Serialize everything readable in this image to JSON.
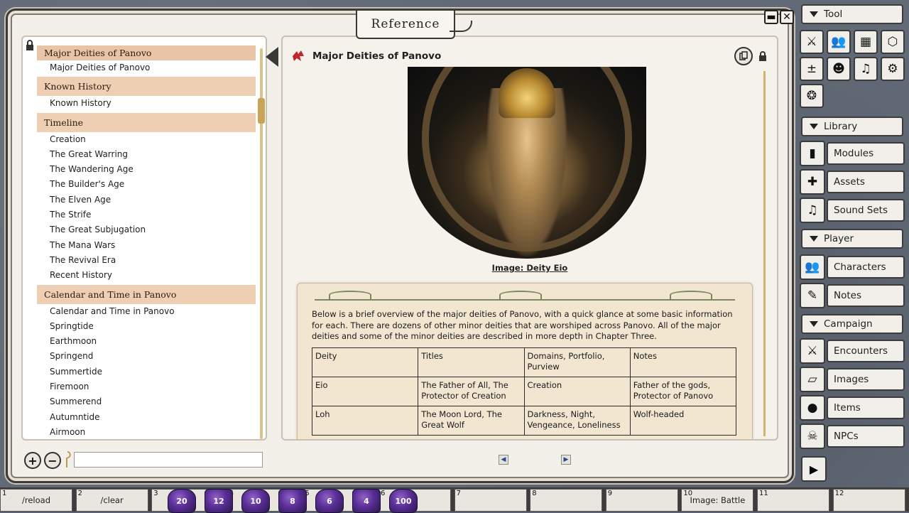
{
  "window": {
    "title": "Reference"
  },
  "list": {
    "groups": [
      {
        "header": "Major Deities of Panovo",
        "items": [
          "Major Deities of Panovo"
        ]
      },
      {
        "header": "Known History",
        "items": [
          "Known History"
        ]
      },
      {
        "header": "Timeline",
        "items": [
          "Creation",
          "The Great Warring",
          "The Wandering Age",
          "The Builder's Age",
          "The Elven Age",
          "The Strife",
          "The Great Subjugation",
          "The Mana Wars",
          "The Revival Era",
          "Recent History"
        ]
      },
      {
        "header": "Calendar and Time in Panovo",
        "items": [
          "Calendar and Time in Panovo",
          "Springtide",
          "Earthmoon",
          "Springend",
          "Summertide",
          "Firemoon",
          "Summerend",
          "Autumntide",
          "Airmoon"
        ]
      }
    ]
  },
  "content": {
    "title": "Major Deities of Panovo",
    "image_caption": "Image: Deity Eio",
    "intro": "Below is a brief overview of the major deities of Panovo, with a quick glance at some basic information for each. There are dozens of other minor deities that are worshiped across Panovo. All of the major deities and some of the minor deities are described in more depth in Chapter Three.",
    "table": {
      "headers": [
        "Deity",
        "Titles",
        "Domains, Portfolio, Purview",
        "Notes"
      ],
      "rows": [
        [
          "Eio",
          "The Father of All, The Protector of Creation",
          "Creation",
          "Father of the gods, Protector of Panovo"
        ],
        [
          "Loh",
          "The Moon Lord, The Great Wolf",
          "Darkness, Night, Vengeance, Loneliness",
          "Wolf-headed"
        ]
      ]
    }
  },
  "sidebar": {
    "tool_header": "Tool",
    "tool_icons": [
      "sword-icon",
      "users-icon",
      "calendar-icon",
      "d20-icon",
      "modifier-icon",
      "user-gear-icon",
      "music-icon",
      "settings-icon",
      "effects-icon"
    ],
    "library_header": "Library",
    "library_items": [
      "Modules",
      "Assets",
      "Sound Sets"
    ],
    "player_header": "Player",
    "player_items": [
      "Characters",
      "Notes"
    ],
    "campaign_header": "Campaign",
    "campaign_items": [
      "Encounters",
      "Images",
      "Items",
      "NPCs"
    ]
  },
  "hotkeys": {
    "slots": [
      {
        "num": "1",
        "label": "/reload"
      },
      {
        "num": "2",
        "label": "/clear"
      },
      {
        "num": "3",
        "label": ""
      },
      {
        "num": "4",
        "label": ""
      },
      {
        "num": "5",
        "label": ""
      },
      {
        "num": "6",
        "label": ""
      },
      {
        "num": "7",
        "label": ""
      },
      {
        "num": "8",
        "label": ""
      },
      {
        "num": "9",
        "label": ""
      },
      {
        "num": "10",
        "label": "Image: Battle"
      },
      {
        "num": "11",
        "label": ""
      },
      {
        "num": "12",
        "label": ""
      }
    ],
    "dice": [
      "20",
      "12",
      "10",
      "8",
      "6",
      "4",
      "100"
    ]
  }
}
